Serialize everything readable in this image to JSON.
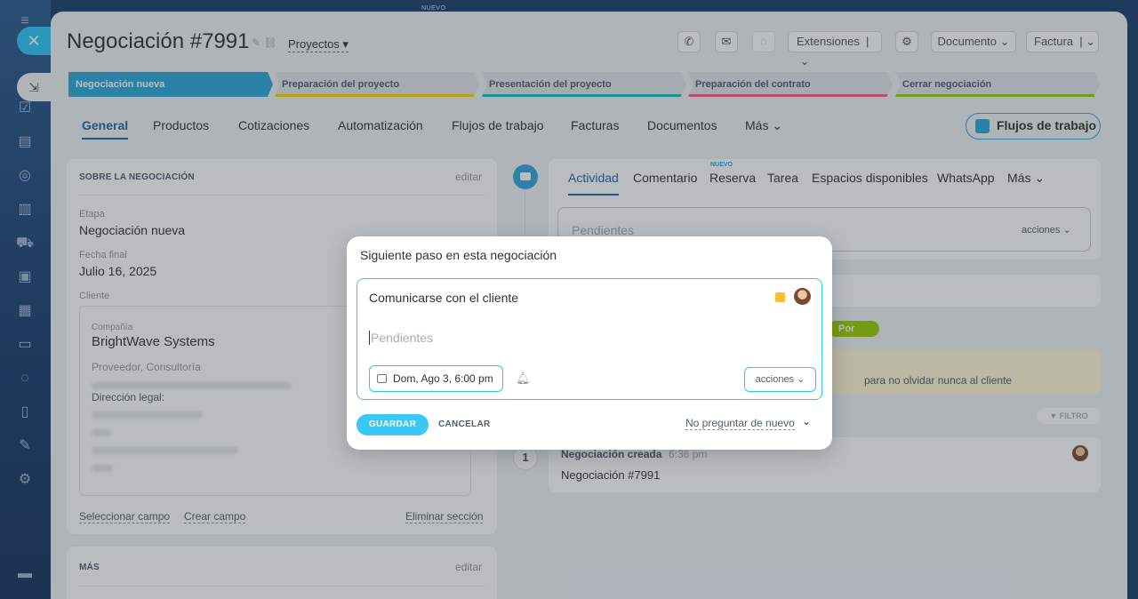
{
  "header": {
    "top_badge": "NUEVO",
    "title": "Negociación #7991",
    "category": "Proyectos",
    "extensions": "Extensiones",
    "document": "Documento",
    "invoice": "Factura"
  },
  "stages": [
    {
      "label": "Negociación nueva",
      "color": "#2fa7d9"
    },
    {
      "label": "Preparación del proyecto",
      "color": "#ffd500"
    },
    {
      "label": "Presentación del proyecto",
      "color": "#13c2c2"
    },
    {
      "label": "Preparación del contrato",
      "color": "#ff5c8a"
    },
    {
      "label": "Cerrar negociación",
      "color": "#9dcf00"
    }
  ],
  "tabs": [
    "General",
    "Productos",
    "Cotizaciones",
    "Automatización",
    "Flujos de trabajo",
    "Facturas",
    "Documentos",
    "Más"
  ],
  "flujos_button": "Flujos de trabajo",
  "about": {
    "heading": "SOBRE LA NEGOCIACIÓN",
    "edit": "editar",
    "stage_label": "Etapa",
    "stage_value": "Negociación nueva",
    "date_label": "Fecha final",
    "date_value": "Julio 16, 2025",
    "client_label": "Cliente",
    "company_label": "Compañía",
    "company_value": "BrightWave Systems",
    "company_type": "Proveedor, Consultoría",
    "legal_address": "Dirección legal:",
    "select_field": "Seleccionar campo",
    "create_field": "Crear campo",
    "delete_section": "Eliminar sección"
  },
  "more_card": {
    "heading": "MÁS",
    "edit": "editar"
  },
  "activity": {
    "tabs": [
      "Actividad",
      "Comentario",
      "Reserva",
      "Tarea",
      "Espacios disponibles",
      "WhatsApp",
      "Más"
    ],
    "new_badge": "NUEVO",
    "pending_placeholder": "Pendientes",
    "actions": "acciones",
    "todo_badge": "Por hacer",
    "reminder_text": "para no olvidar nunca al cliente",
    "filter": "FILTRO",
    "created_title": "Negociación creada",
    "created_time": "6:36 pm",
    "created_body": "Negociación #7991",
    "timeline_number": "1"
  },
  "modal": {
    "title": "Siguiente paso en esta negociación",
    "subject": "Comunicarse con el cliente",
    "placeholder": "Pendientes",
    "datetime": "Dom, Ago 3, 6:00 pm",
    "actions": "acciones",
    "save": "GUARDAR",
    "cancel": "CANCELAR",
    "dont_ask": "No preguntar de nuevo"
  },
  "colors": {
    "accent": "#2fc6f6",
    "link_blue": "#2066b0",
    "flag": "#fbc02d"
  }
}
